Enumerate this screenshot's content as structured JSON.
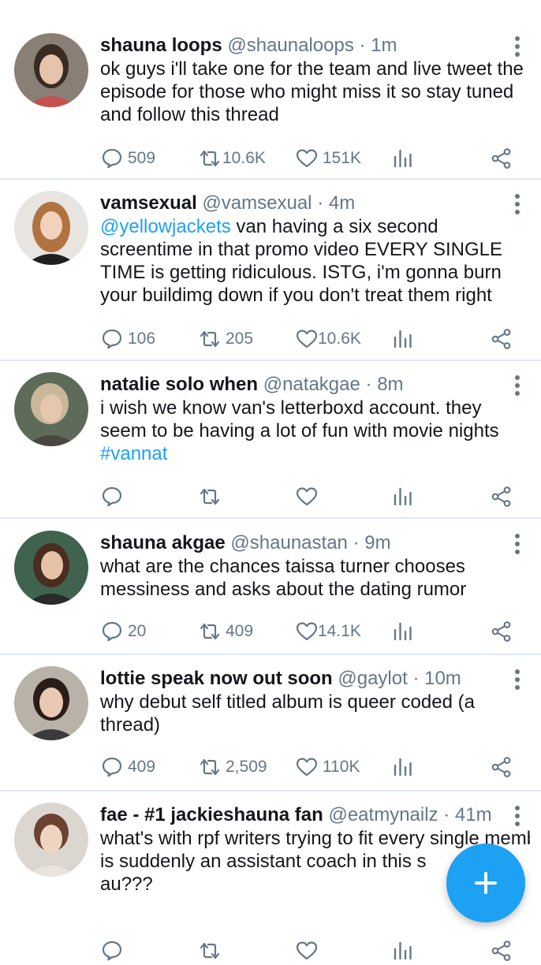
{
  "tweets": [
    {
      "name": "shauna loops",
      "handle": "@shaunaloops",
      "sep": "·",
      "time": "1m",
      "text_parts": [
        {
          "text": "ok guys i'll take one for the team and live tweet the episode for those who might miss it so stay tuned and follow this thread",
          "link": false
        }
      ],
      "replies": "509",
      "retweets": "10.6K",
      "likes": "151K",
      "avatar": {
        "bg": "#8a7f74",
        "skin": "#e5c3ad",
        "hair": "#3a2b22",
        "shirt": "#c4524f"
      }
    },
    {
      "name": "vamsexual",
      "handle": "@vamsexual",
      "sep": "·",
      "time": "4m",
      "text_parts": [
        {
          "text": "@yellowjackets",
          "link": true
        },
        {
          "text": " van having a six second screentime in that promo video EVERY SINGLE TIME is getting ridiculous. ISTG, i'm gonna burn your buildimg down if you don't treat them right",
          "link": false
        }
      ],
      "replies": "106",
      "retweets": "205",
      "likes": "10.6K",
      "avatar": {
        "bg": "#e8e4df",
        "skin": "#f0d2bd",
        "hair": "#b0733f",
        "shirt": "#1f1f1f"
      }
    },
    {
      "name": "natalie solo when",
      "handle": "@natakgae",
      "sep": "·",
      "time": "8m",
      "text_parts": [
        {
          "text": "i wish we know van's letterboxd account. they seem to be having a lot of fun with movie nights ",
          "link": false
        },
        {
          "text": "#vannat",
          "link": true
        }
      ],
      "replies": "",
      "retweets": "",
      "likes": "",
      "avatar": {
        "bg": "#5d6b58",
        "skin": "#e6c7ad",
        "hair": "#c9b79a",
        "shirt": "#4a4740"
      }
    },
    {
      "name": "shauna akgae",
      "handle": "@shaunastan",
      "sep": "·",
      "time": "9m",
      "text_parts": [
        {
          "text": "what are the chances taissa turner chooses messiness and asks about the dating rumor",
          "link": false
        }
      ],
      "replies": "20",
      "retweets": "409",
      "likes": "14.1K",
      "avatar": {
        "bg": "#40634f",
        "skin": "#e8c2a6",
        "hair": "#4b2d1f",
        "shirt": "#2a2a2a"
      }
    },
    {
      "name": "lottie speak now out soon",
      "handle": "@gaylot",
      "sep": "·",
      "time": "10m",
      "text_parts": [
        {
          "text": "why debut self titled album is queer coded (a thread)",
          "link": false
        }
      ],
      "replies": "409",
      "retweets": "2,509",
      "likes": "110K",
      "avatar": {
        "bg": "#b9b2a9",
        "skin": "#e9c9b4",
        "hair": "#2a1c17",
        "shirt": "#3d3a3c"
      }
    },
    {
      "name": "fae - #1 jackieshauna fan",
      "handle": "@eatmynailz",
      "sep": "·",
      "time": "41m",
      "text_parts": [
        {
          "text": "what's with rpf writers trying to fit every single member of the band in fics bcs wdym b",
          "link": false
        },
        {
          "text": "is suddenly an assistant coach in this s",
          "link": false
        },
        {
          "text": "au???",
          "link": false
        }
      ],
      "replies": "",
      "retweets": "",
      "likes": "",
      "avatar": {
        "bg": "#dcd6d0",
        "skin": "#efd4c2",
        "hair": "#6b4330",
        "shirt": "#e9e3dd"
      }
    }
  ],
  "icons": {
    "reply": "reply-icon",
    "retweet": "retweet-icon",
    "like": "heart-icon",
    "analytics": "analytics-icon",
    "share": "share-icon",
    "more": "more-vertical-icon",
    "compose": "plus-icon"
  },
  "colors": {
    "link": "#1da1f2",
    "text": "#14171a",
    "muted": "#657786",
    "divider": "#e1e8ed",
    "fab": "#1da1f2"
  }
}
